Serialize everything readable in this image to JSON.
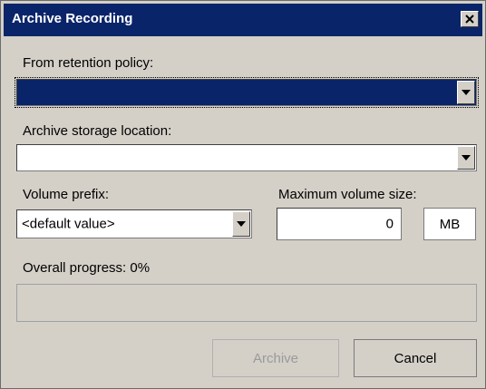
{
  "dialog": {
    "title": "Archive Recording",
    "close_icon": "close-icon"
  },
  "retention": {
    "label": "From retention policy:",
    "value": ""
  },
  "storage": {
    "label": "Archive storage location:",
    "value": ""
  },
  "volume_prefix": {
    "label": "Volume prefix:",
    "value": "<default value>"
  },
  "max_volume": {
    "label": "Maximum volume size:",
    "value": "0",
    "unit": "MB"
  },
  "progress": {
    "label": "Overall progress: 0%",
    "percent": 0
  },
  "buttons": {
    "archive": "Archive",
    "cancel": "Cancel"
  },
  "colors": {
    "titlebar": "#0a246a",
    "face": "#d4d0c8"
  }
}
